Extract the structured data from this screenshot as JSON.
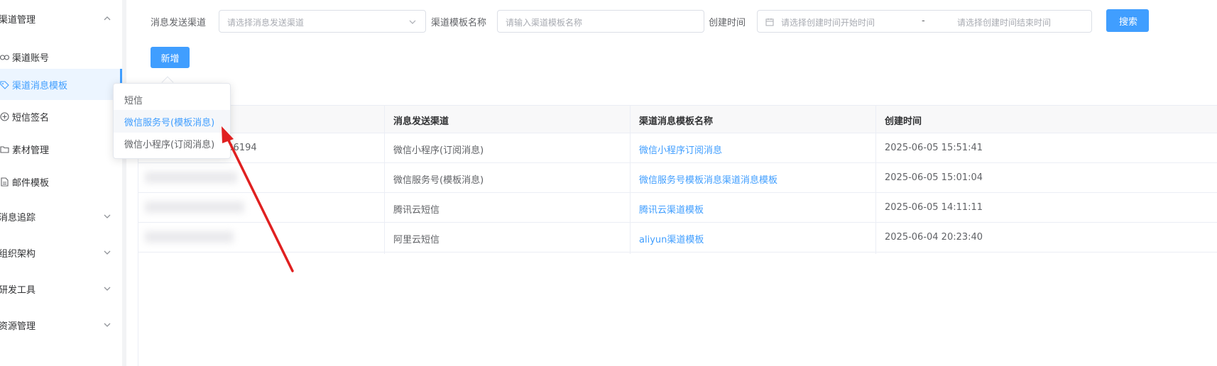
{
  "sidebar": {
    "group_channel": "渠道管理",
    "items": [
      {
        "label": "渠道账号",
        "icon": "link-icon"
      },
      {
        "label": "渠道消息模板",
        "icon": "tag-icon"
      },
      {
        "label": "短信签名",
        "icon": "add-circle-icon"
      },
      {
        "label": "素材管理",
        "icon": "folder-icon"
      },
      {
        "label": "邮件模板",
        "icon": "document-icon"
      }
    ],
    "groups": [
      {
        "label": "消息追踪"
      },
      {
        "label": "组织架构"
      },
      {
        "label": "研发工具"
      },
      {
        "label": "资源管理"
      }
    ]
  },
  "filters": {
    "channel_label": "消息发送渠道",
    "channel_placeholder": "请选择消息发送渠道",
    "template_label": "渠道模板名称",
    "template_placeholder": "请输入渠道模板名称",
    "time_label": "创建时间",
    "time_start_placeholder": "请选择创建时间开始时间",
    "time_separator": "-",
    "time_end_placeholder": "请选择创建时间结束时间",
    "search_button": "搜索"
  },
  "toolbar": {
    "add_button": "新增"
  },
  "dropdown": {
    "options": [
      "短信",
      "微信服务号(模板消息)",
      "微信小程序(订阅消息)"
    ],
    "hovered_index": 1
  },
  "table": {
    "columns": [
      "消息发送渠道",
      "渠道消息模板名称",
      "创建时间"
    ],
    "rows": [
      {
        "id": "736194",
        "channel": "微信小程序(订阅消息)",
        "name": "微信小程序订阅消息",
        "created": "2025-06-05 15:51:41"
      },
      {
        "id": "",
        "channel": "微信服务号(模板消息)",
        "name": "微信服务号模板消息渠道消息模板",
        "created": "2025-06-05 15:01:04"
      },
      {
        "id": "",
        "channel": "腾讯云短信",
        "name": "腾讯云渠道模板",
        "created": "2025-06-05 14:11:11"
      },
      {
        "id": "",
        "channel": "阿里云短信",
        "name": "aliyun渠道模板",
        "created": "2025-06-04 20:23:40"
      }
    ]
  },
  "colors": {
    "accent": "#409eff",
    "annotation_arrow": "#e02020"
  }
}
